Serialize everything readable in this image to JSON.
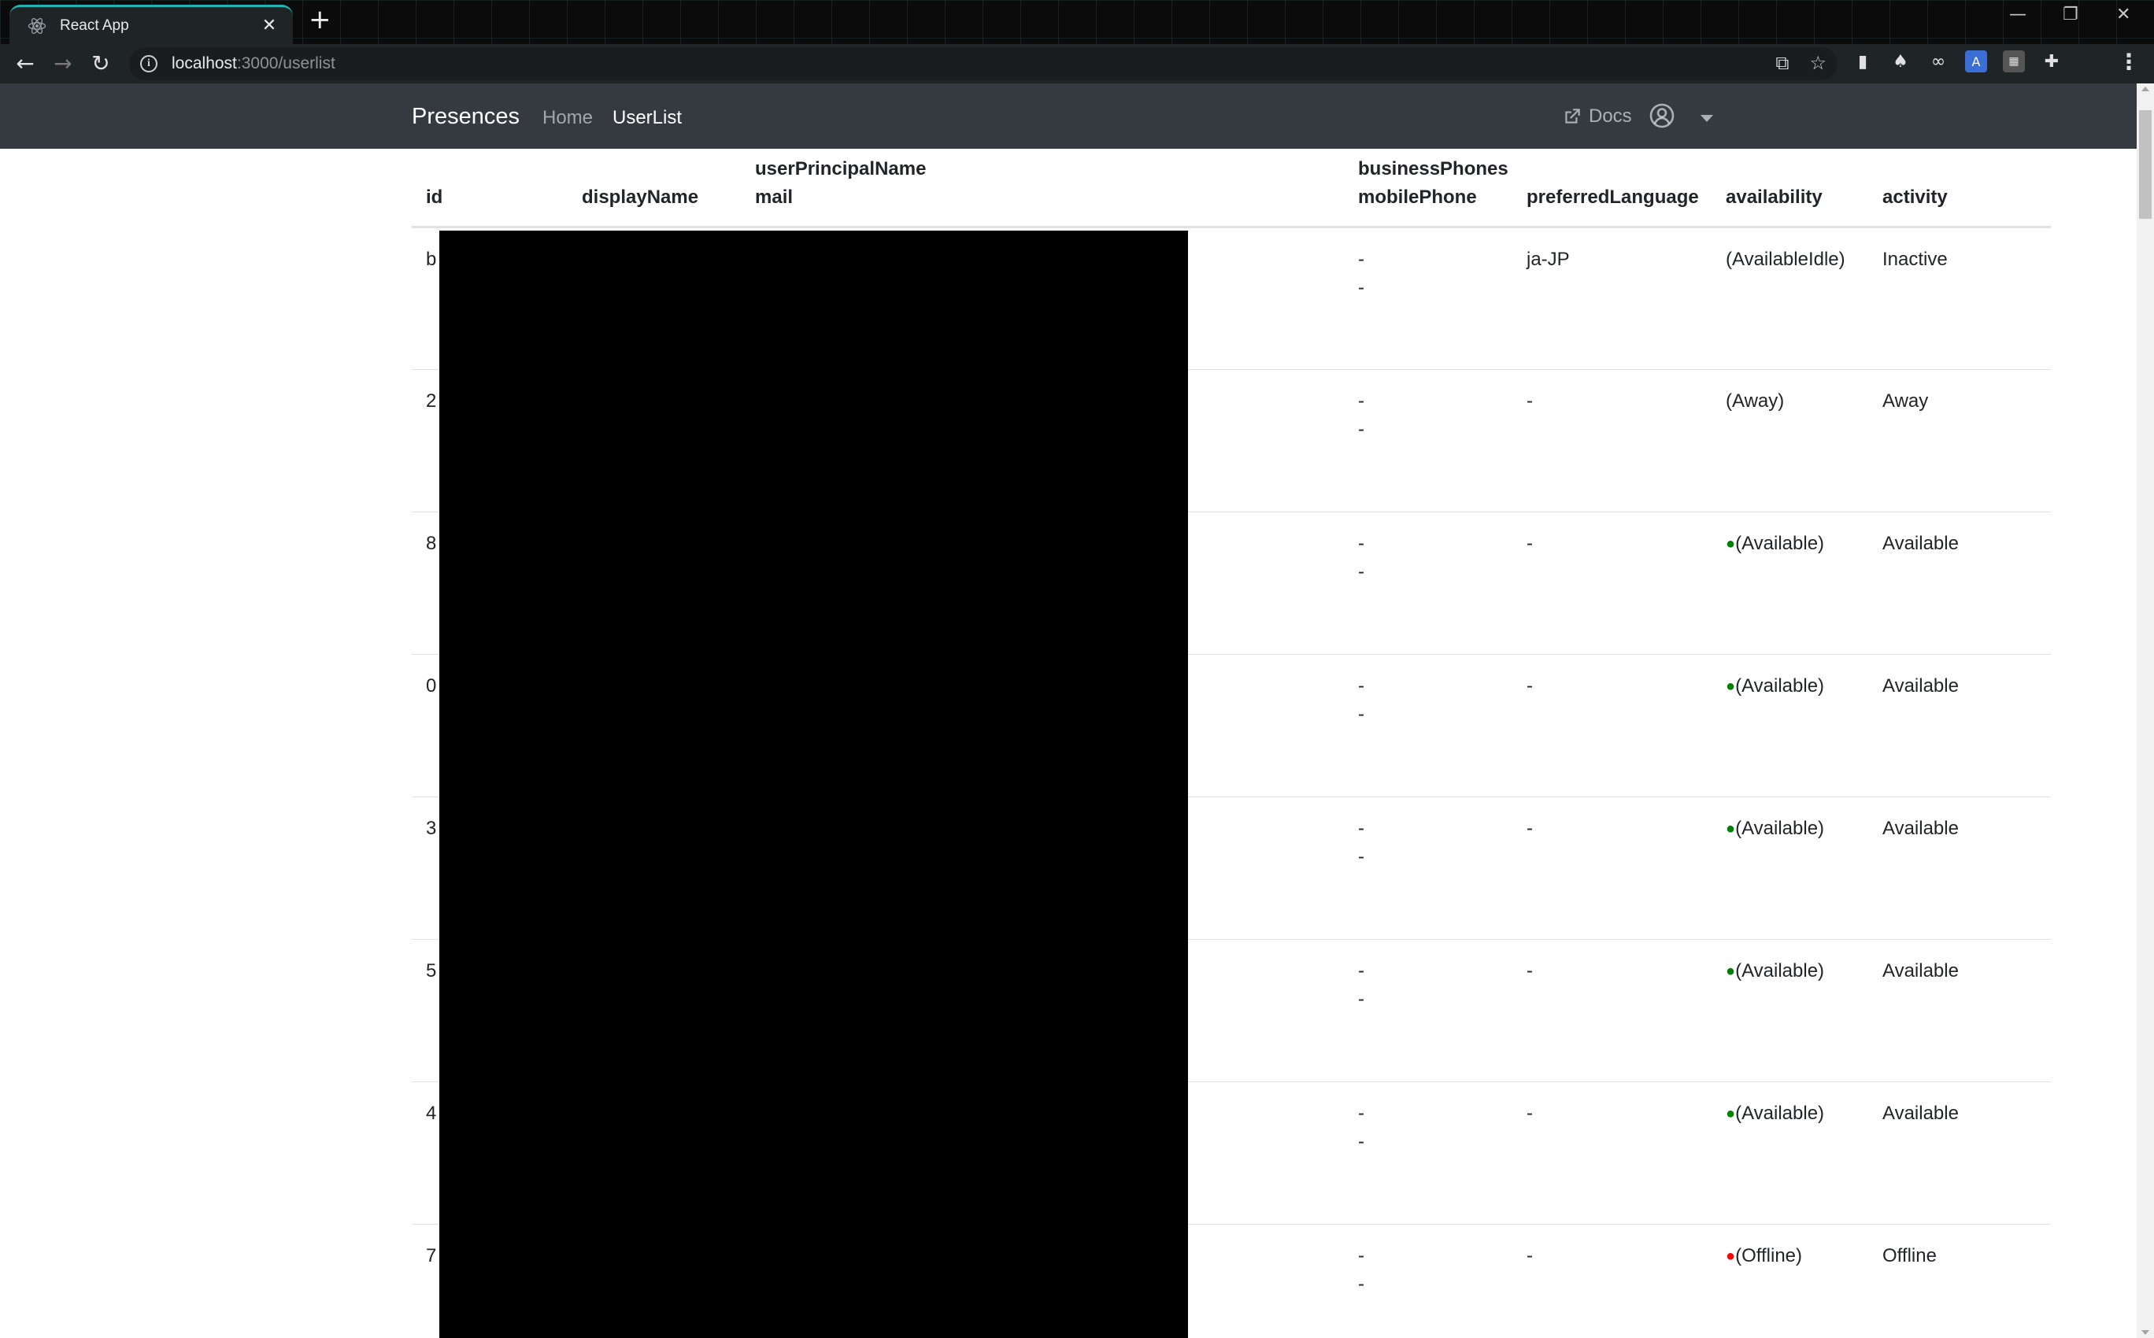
{
  "browser": {
    "tab_title": "React App",
    "new_tab": "+",
    "url_host": "localhost",
    "url_path": ":3000/userlist",
    "window_controls": {
      "minimize": "—",
      "restore": "❐",
      "close": "✕"
    }
  },
  "navbar": {
    "brand": "Presences",
    "links": [
      "Home",
      "UserList"
    ],
    "docs": "Docs"
  },
  "table": {
    "columns": {
      "id": "id",
      "displayName": "displayName",
      "userPrincipalName": "userPrincipalName",
      "mail": "mail",
      "businessPhones": "businessPhones",
      "mobilePhone": "mobilePhone",
      "preferredLanguage": "preferredLanguage",
      "availability": "availability",
      "activity": "activity"
    },
    "rows": [
      {
        "id": "b",
        "businessPhones": "-",
        "mobilePhone": "-",
        "preferredLanguage": "ja-JP",
        "dot": "",
        "availability": "(AvailableIdle)",
        "activity": "Inactive"
      },
      {
        "id": "2",
        "businessPhones": "-",
        "mobilePhone": "-",
        "preferredLanguage": "-",
        "dot": "",
        "availability": "(Away)",
        "activity": "Away"
      },
      {
        "id": "8",
        "businessPhones": "-",
        "mobilePhone": "-",
        "preferredLanguage": "-",
        "dot": "●",
        "availability": "(Available)",
        "activity": "Available"
      },
      {
        "id": "0",
        "businessPhones": "-",
        "mobilePhone": "-",
        "preferredLanguage": "-",
        "dot": "●",
        "availability": "(Available)",
        "activity": "Available"
      },
      {
        "id": "3",
        "businessPhones": "-",
        "mobilePhone": "-",
        "preferredLanguage": "-",
        "dot": "●",
        "availability": "(Available)",
        "activity": "Available"
      },
      {
        "id": "5",
        "businessPhones": "-",
        "mobilePhone": "-",
        "preferredLanguage": "-",
        "dot": "●",
        "availability": "(Available)",
        "activity": "Available"
      },
      {
        "id": "4",
        "businessPhones": "-",
        "mobilePhone": "-",
        "preferredLanguage": "-",
        "dot": "●",
        "availability": "(Available)",
        "activity": "Available"
      },
      {
        "id": "7",
        "businessPhones": "-",
        "mobilePhone": "-",
        "preferredLanguage": "-",
        "dot": "●",
        "availability": "(Offline)",
        "activity": "Offline"
      }
    ]
  },
  "colors": {
    "available_dot": "#008000",
    "offline_dot": "#ff0000",
    "navbar_bg": "#343a40",
    "tab_accent": "#1fb3b3"
  }
}
